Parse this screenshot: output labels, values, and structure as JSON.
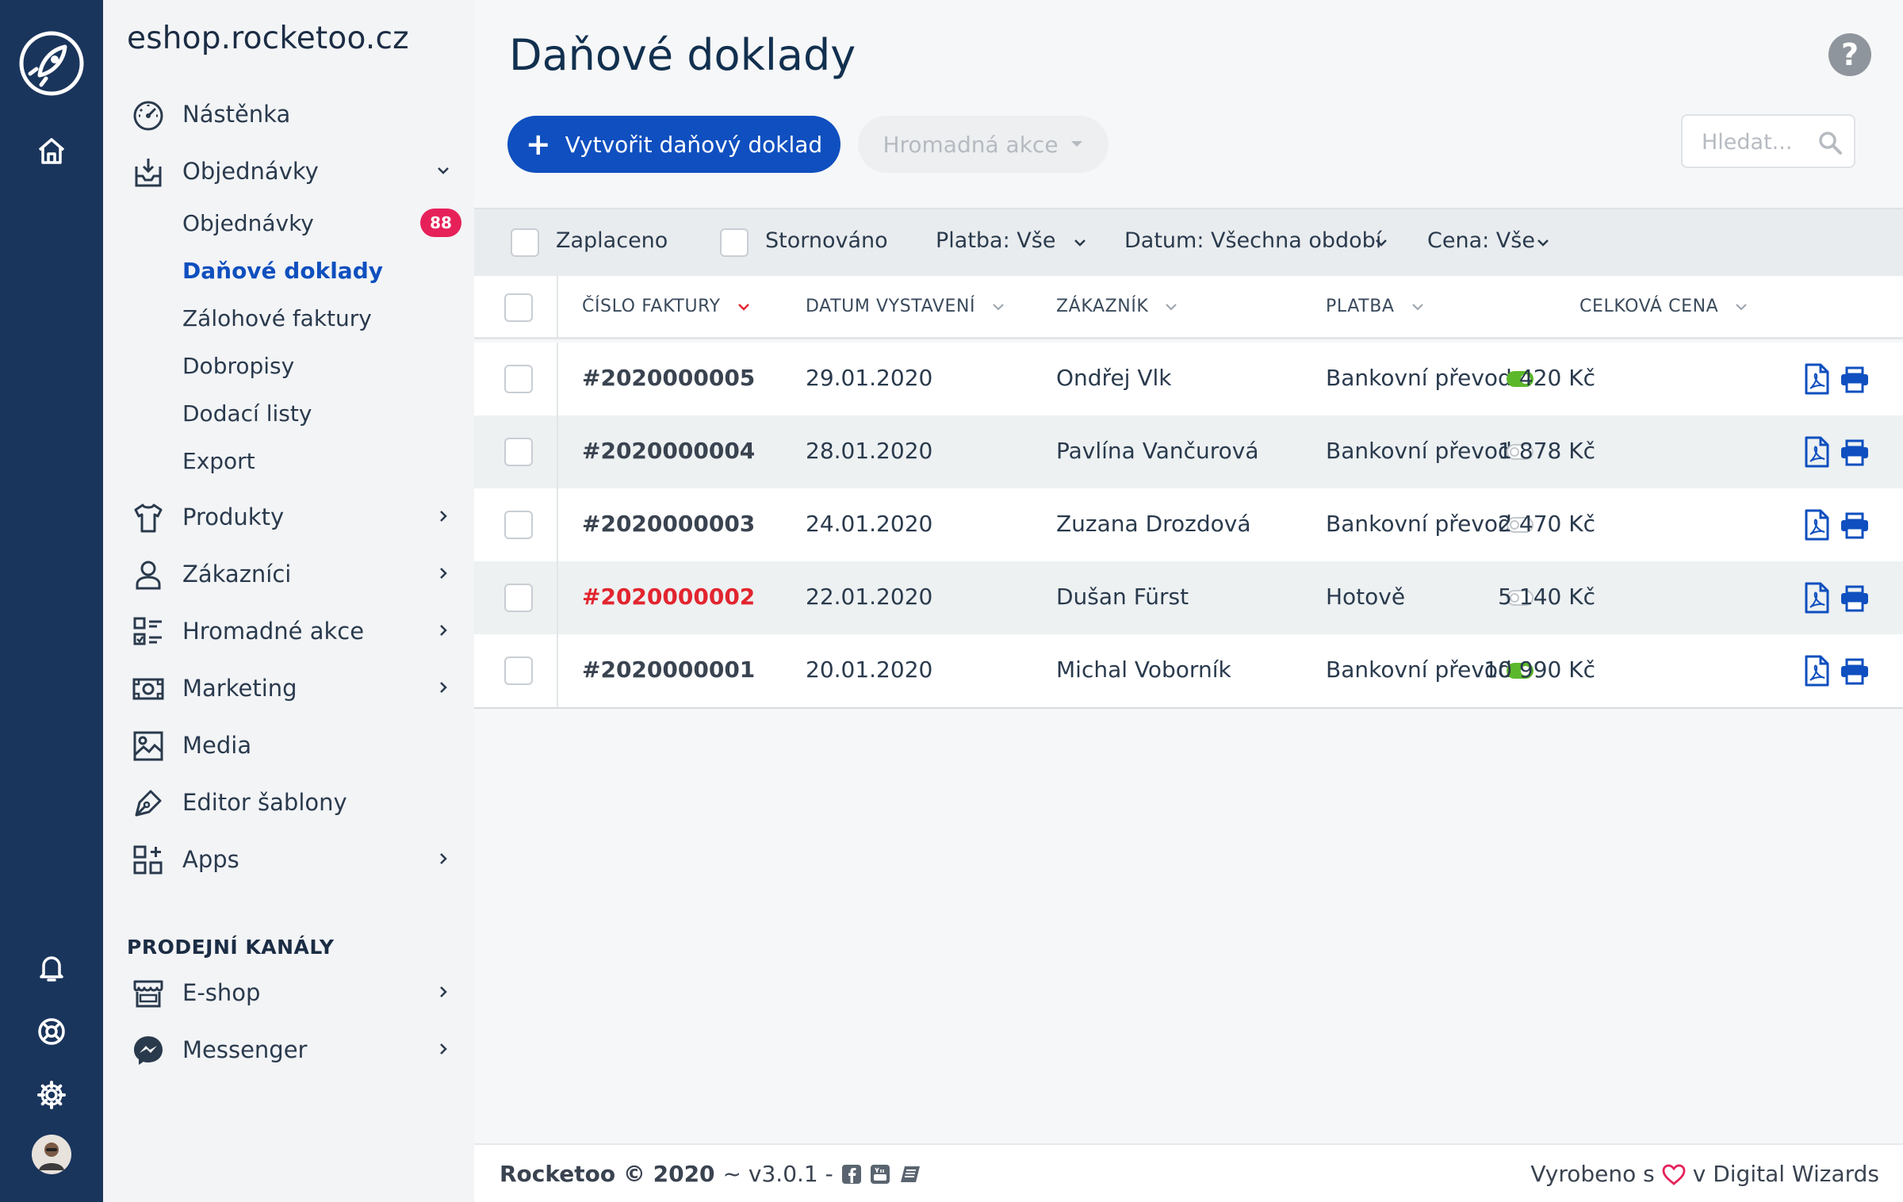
{
  "app": {
    "store_name": "eshop.rocketoo.cz"
  },
  "sidebar": {
    "items": [
      {
        "label": "Nástěnka"
      },
      {
        "label": "Objednávky"
      },
      {
        "label": "Produkty"
      },
      {
        "label": "Zákazníci"
      },
      {
        "label": "Hromadné akce"
      },
      {
        "label": "Marketing"
      },
      {
        "label": "Media"
      },
      {
        "label": "Editor šablony"
      },
      {
        "label": "Apps"
      }
    ],
    "orders_sub": [
      {
        "label": "Objednávky",
        "badge": "88"
      },
      {
        "label": "Daňové doklady"
      },
      {
        "label": "Zálohové faktury"
      },
      {
        "label": "Dobropisy"
      },
      {
        "label": "Dodací listy"
      },
      {
        "label": "Export"
      }
    ],
    "channels_title": "PRODEJNÍ KANÁLY",
    "channels": [
      {
        "label": "E-shop"
      },
      {
        "label": "Messenger"
      }
    ]
  },
  "page": {
    "title": "Daňové doklady",
    "help_glyph": "?",
    "create_button": "Vytvořit daňový doklad",
    "bulk_button": "Hromadná akce",
    "search_placeholder": "Hledat..."
  },
  "filters": {
    "paid": "Zaplaceno",
    "cancelled": "Stornováno",
    "payment": "Platba:  Vše",
    "date": "Datum: Všechna období",
    "price": "Cena: Vše"
  },
  "table": {
    "columns": [
      "ČÍSLO FAKTURY",
      "DATUM VYSTAVENÍ",
      "ZÁKAZNÍK",
      "PLATBA",
      "CELKOVÁ CENA"
    ],
    "rows": [
      {
        "number": "#2020000005",
        "date": "29.01.2020",
        "customer": "Ondřej Vlk",
        "payment": "Bankovní převod",
        "paid": true,
        "price": "420 Kč",
        "highlight": false
      },
      {
        "number": "#2020000004",
        "date": "28.01.2020",
        "customer": "Pavlína Vančurová",
        "payment": "Bankovní převod",
        "paid": false,
        "price": "1 878 Kč",
        "highlight": false
      },
      {
        "number": "#2020000003",
        "date": "24.01.2020",
        "customer": "Zuzana Drozdová",
        "payment": "Bankovní převod",
        "paid": false,
        "price": "2 470 Kč",
        "highlight": false
      },
      {
        "number": "#2020000002",
        "date": "22.01.2020",
        "customer": "Dušan Fürst",
        "payment": "Hotově",
        "paid": false,
        "price": "5 140 Kč",
        "highlight": true
      },
      {
        "number": "#2020000001",
        "date": "20.01.2020",
        "customer": "Michal Voborník",
        "payment": "Bankovní převod",
        "paid": true,
        "price": "10 990 Kč",
        "highlight": false
      }
    ]
  },
  "footer": {
    "brand": "Rocketoo © 2020",
    "version": "~ v3.0.1 -",
    "made_prefix": "Vyrobeno s",
    "made_suffix": "v Digital Wizards"
  },
  "colors": {
    "rail": "#1a355c",
    "primary": "#0f4fbf",
    "badge": "#e6215a",
    "toggle_on": "#5cb82b",
    "invoice_alert": "#e2252f"
  },
  "icons": {
    "rail": [
      "rocket-logo-icon",
      "home-icon",
      "bell-icon",
      "lifebuoy-icon",
      "gear-icon",
      "avatar"
    ],
    "row_actions": [
      "pdf-icon",
      "printer-icon"
    ]
  }
}
